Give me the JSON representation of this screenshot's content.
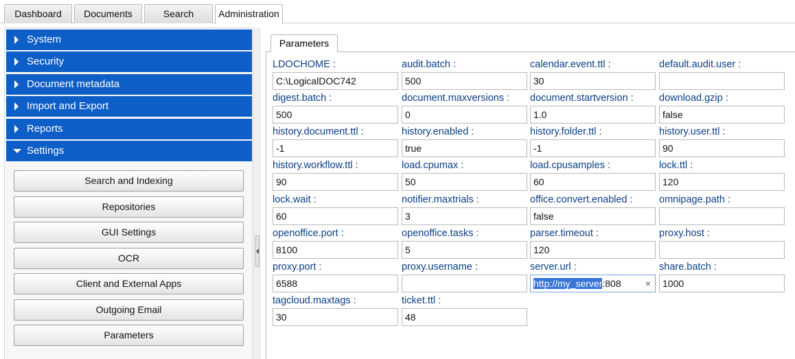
{
  "top_tabs": [
    "Dashboard",
    "Documents",
    "Search",
    "Administration"
  ],
  "sidebar": {
    "sections": [
      "System",
      "Security",
      "Document metadata",
      "Import and Export",
      "Reports",
      "Settings"
    ],
    "settings_items": [
      "Search and Indexing",
      "Repositories",
      "GUI Settings",
      "OCR",
      "Client and External Apps",
      "Outgoing Email",
      "Parameters"
    ]
  },
  "content": {
    "tab_label": "Parameters",
    "fields": [
      {
        "label": "LDOCHOME :",
        "value": "C:\\LogicalDOC742"
      },
      {
        "label": "audit.batch :",
        "value": "500"
      },
      {
        "label": "calendar.event.ttl :",
        "value": "30"
      },
      {
        "label": "default.audit.user :",
        "value": ""
      },
      {
        "label": "digest.batch :",
        "value": "500"
      },
      {
        "label": "document.maxversions :",
        "value": "0"
      },
      {
        "label": "document.startversion :",
        "value": "1.0"
      },
      {
        "label": "download.gzip :",
        "value": "false"
      },
      {
        "label": "history.document.ttl :",
        "value": "-1"
      },
      {
        "label": "history.enabled :",
        "value": "true"
      },
      {
        "label": "history.folder.ttl :",
        "value": "-1"
      },
      {
        "label": "history.user.ttl :",
        "value": "90"
      },
      {
        "label": "history.workflow.ttl :",
        "value": "90"
      },
      {
        "label": "load.cpumax :",
        "value": "50"
      },
      {
        "label": "load.cpusamples :",
        "value": "60"
      },
      {
        "label": "lock.ttl :",
        "value": "120"
      },
      {
        "label": "lock.wait :",
        "value": "60"
      },
      {
        "label": "notifier.maxtrials :",
        "value": "3"
      },
      {
        "label": "office.convert.enabled :",
        "value": "false"
      },
      {
        "label": "omnipage.path :",
        "value": ""
      },
      {
        "label": "openoffice.port :",
        "value": "8100"
      },
      {
        "label": "openoffice.tasks :",
        "value": "5"
      },
      {
        "label": "parser.timeout :",
        "value": "120"
      },
      {
        "label": "proxy.host :",
        "value": ""
      },
      {
        "label": "proxy.port :",
        "value": "6588"
      },
      {
        "label": "proxy.username :",
        "value": ""
      },
      {
        "label": "server.url :",
        "value_selected": "http://my_server",
        "value_rest": ":808",
        "clear_glyph": "×"
      },
      {
        "label": "share.batch :",
        "value": "1000"
      },
      {
        "label": "tagcloud.maxtags :",
        "value": "30"
      },
      {
        "label": "ticket.ttl :",
        "value": "48"
      }
    ]
  },
  "colors": {
    "section_header": "#0d5ec7",
    "field_label": "#0b3f87",
    "selection": "#3875d7"
  },
  "icons": {
    "collapsed_arrow": "triangle-right-icon",
    "expanded_arrow": "triangle-down-icon",
    "splitter": "collapse-left-icon"
  }
}
